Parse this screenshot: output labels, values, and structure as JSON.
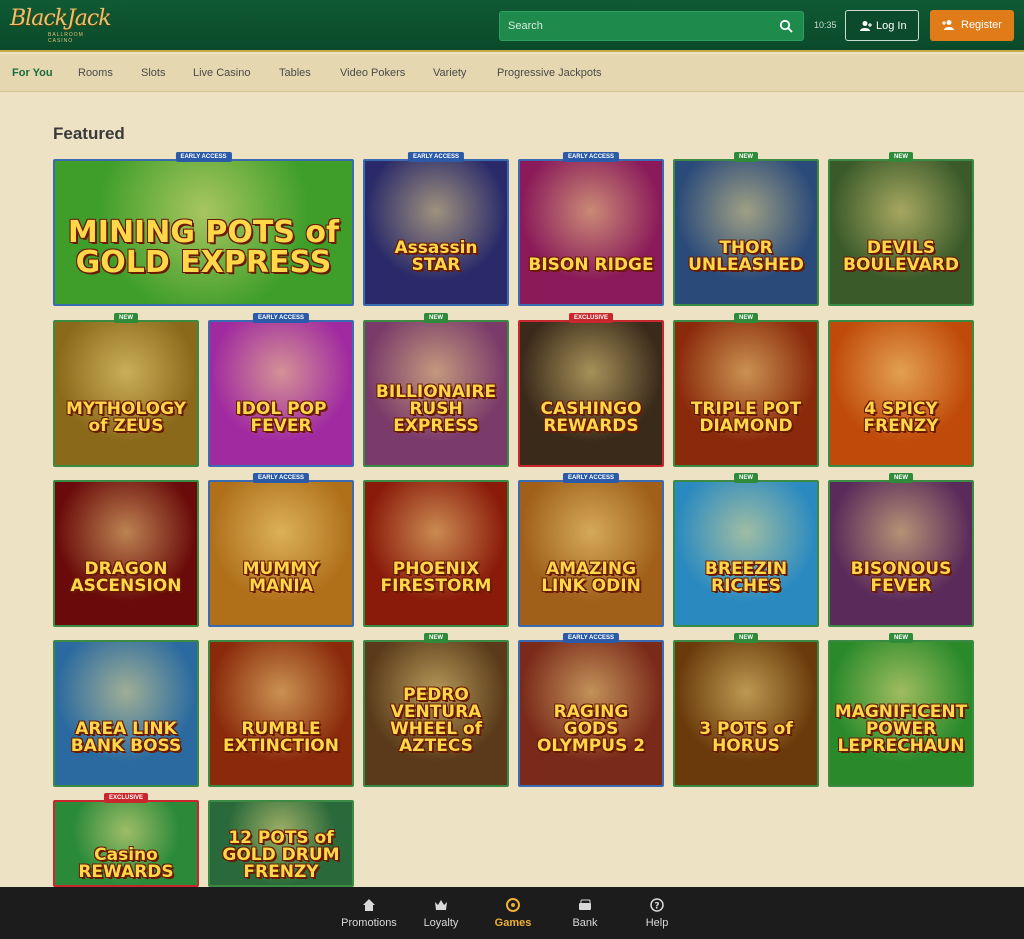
{
  "header": {
    "logo_main": "BlackJack",
    "logo_sub": "BALLROOM CASINO",
    "search_placeholder": "Search",
    "time": "10:35",
    "login_label": "Log In",
    "register_label": "Register"
  },
  "nav": {
    "items": [
      {
        "label": "For You",
        "active": true
      },
      {
        "label": "Rooms"
      },
      {
        "label": "Slots"
      },
      {
        "label": "Live Casino"
      },
      {
        "label": "Tables"
      },
      {
        "label": "Video Pokers"
      },
      {
        "label": "Variety"
      },
      {
        "label": "Progressive Jackpots"
      }
    ]
  },
  "section": {
    "title": "Featured"
  },
  "games": [
    {
      "title": "MINING POTS of GOLD EXPRESS",
      "badge": "EARLY ACCESS",
      "bg": "#3f9e2a"
    },
    {
      "title": "Assassin STAR",
      "badge": "EARLY ACCESS",
      "bg": "#2a2a6a"
    },
    {
      "title": "BISON RIDGE",
      "badge": "EARLY ACCESS",
      "bg": "#8a1a5a"
    },
    {
      "title": "THOR UNLEASHED",
      "badge": "NEW",
      "bg": "#2a4a7a"
    },
    {
      "title": "DEVILS BOULEVARD",
      "badge": "NEW",
      "bg": "#3a5a2a"
    },
    {
      "title": "MYTHOLOGY of ZEUS",
      "badge": "NEW",
      "bg": "#8a6a1a"
    },
    {
      "title": "IDOL POP FEVER",
      "badge": "EARLY ACCESS",
      "bg": "#a02aa0"
    },
    {
      "title": "BILLIONAIRE RUSH EXPRESS",
      "badge": "NEW",
      "bg": "#7a3a6a"
    },
    {
      "title": "CASHINGO REWARDS",
      "badge": "EXCLUSIVE",
      "bg": "#3a2a1a"
    },
    {
      "title": "TRIPLE POT DIAMOND",
      "badge": "NEW",
      "bg": "#8a2a0a"
    },
    {
      "title": "4 SPICY FRENZY",
      "badge": "",
      "bg": "#c04a0a"
    },
    {
      "title": "DRAGON ASCENSION",
      "badge": "",
      "bg": "#6a0a0a"
    },
    {
      "title": "MUMMY MANIA",
      "badge": "EARLY ACCESS",
      "bg": "#b0701a"
    },
    {
      "title": "PHOENIX FIRESTORM",
      "badge": "",
      "bg": "#8a1a0a"
    },
    {
      "title": "AMAZING LINK ODIN",
      "badge": "EARLY ACCESS",
      "bg": "#a0601a"
    },
    {
      "title": "BREEZIN RICHES",
      "badge": "NEW",
      "bg": "#2a8ac0"
    },
    {
      "title": "BISONOUS FEVER",
      "badge": "NEW",
      "bg": "#5a2a5a"
    },
    {
      "title": "AREA LINK BANK BOSS",
      "badge": "",
      "bg": "#2a6aa0"
    },
    {
      "title": "RUMBLE EXTINCTION",
      "badge": "",
      "bg": "#8a2a0a"
    },
    {
      "title": "PEDRO VENTURA WHEEL of AZTECS",
      "badge": "NEW",
      "bg": "#5a3a1a"
    },
    {
      "title": "RAGING GODS OLYMPUS 2",
      "badge": "EARLY ACCESS",
      "bg": "#7a2a1a"
    },
    {
      "title": "3 POTS of HORUS",
      "badge": "NEW",
      "bg": "#6a3a0a"
    },
    {
      "title": "MAGNIFICENT POWER LEPRECHAUN",
      "badge": "NEW",
      "bg": "#2a8a2a"
    },
    {
      "title": "Casino REWARDS",
      "badge": "EXCLUSIVE",
      "bg": "#2a8a3a"
    },
    {
      "title": "12 POTS of GOLD DRUM FRENZY",
      "badge": "",
      "bg": "#2a6a3a"
    }
  ],
  "bottom_nav": [
    {
      "label": "Promotions",
      "icon": "home-icon"
    },
    {
      "label": "Loyalty",
      "icon": "crown-icon"
    },
    {
      "label": "Games",
      "icon": "games-icon",
      "active": true
    },
    {
      "label": "Bank",
      "icon": "bank-icon"
    },
    {
      "label": "Help",
      "icon": "help-icon"
    }
  ],
  "colors": {
    "header": "#0f5a34",
    "accent": "#e07b1a",
    "background": "#ede2c4",
    "active_tab": "#f0b030"
  }
}
